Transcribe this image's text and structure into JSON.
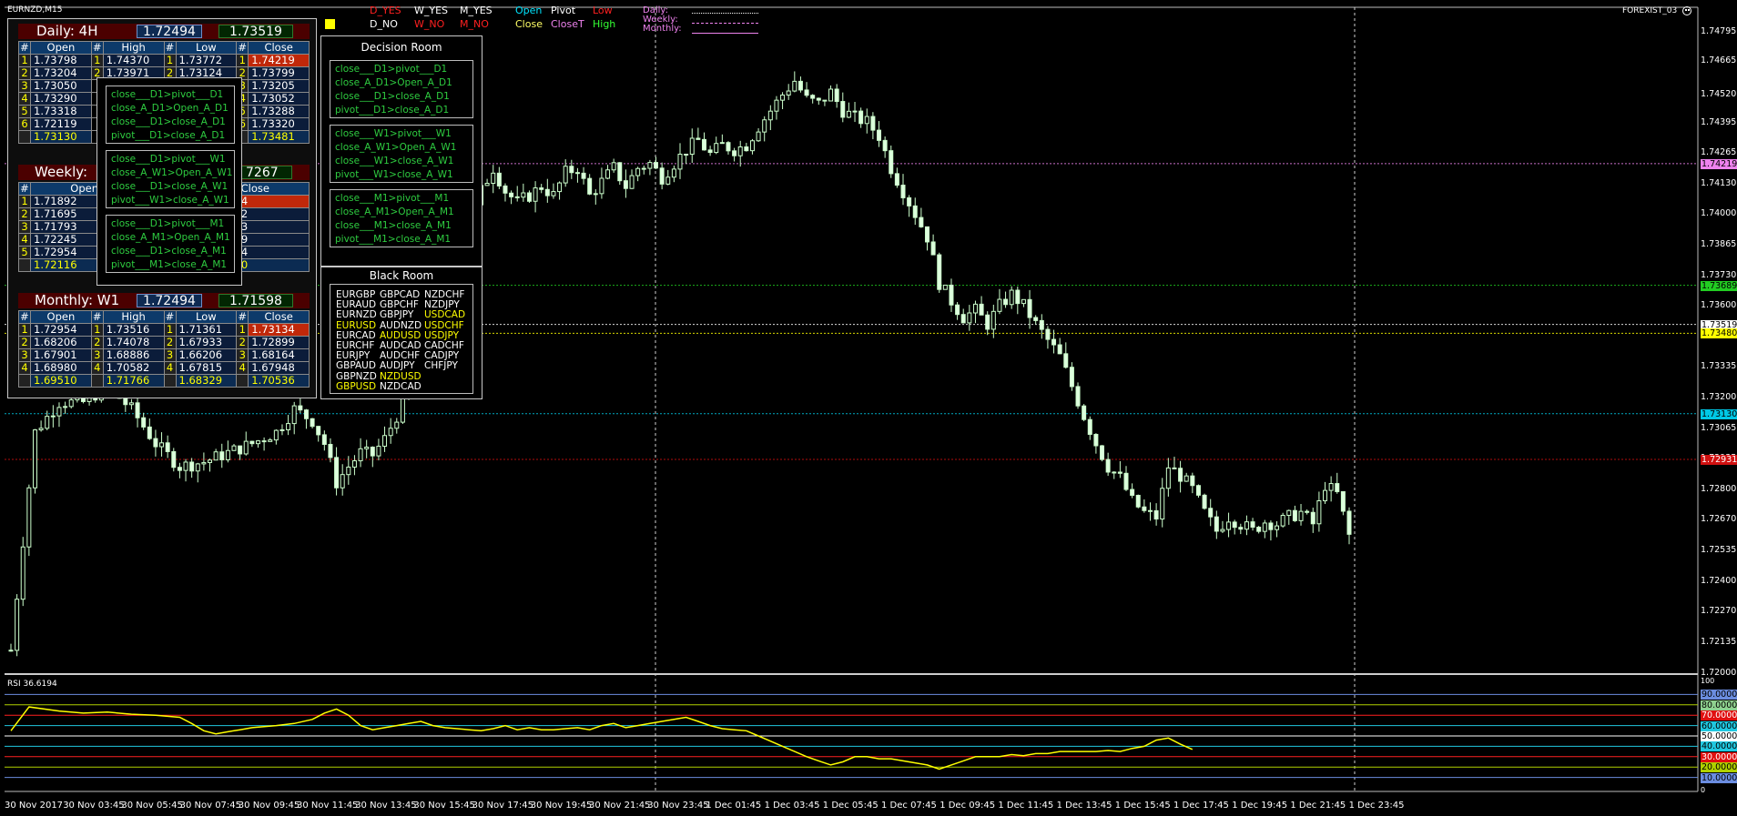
{
  "symbol": "EURNZD,M15",
  "broker": "FOREXIST_03",
  "smiley_icon": "smiley-icon",
  "legend": {
    "d_yes": "D_YES",
    "w_yes": "W_YES",
    "m_yes": "M_YES",
    "d_no": "D_NO",
    "w_no": "W_NO",
    "m_no": "M_NO",
    "open": "Open",
    "pivot": "Pivot",
    "low": "Low",
    "close": "Close",
    "closeT": "CloseT",
    "high": "High",
    "daily": "Daily:",
    "weekly": "Weekly:",
    "monthly": "Monthly:",
    "colors": {
      "red": "#ff2020",
      "white": "#ffffff",
      "cyan": "#00e5ff",
      "yellow": "#ffff66",
      "violet": "#ee82ee",
      "green": "#33ff33"
    }
  },
  "daily": {
    "title": "Daily:  4H",
    "val1": "1.72494",
    "val2": "1.73519",
    "headers": [
      "#",
      "Open",
      "#",
      "High",
      "#",
      "Low",
      "#",
      "Close"
    ],
    "rows": [
      [
        "1",
        "1.73798",
        "1",
        "1.74370",
        "1",
        "1.73772",
        "1",
        "1.74219"
      ],
      [
        "2",
        "1.73204",
        "2",
        "1.73971",
        "2",
        "1.73124",
        "2",
        "1.73799"
      ],
      [
        "3",
        "1.73050",
        "",
        "",
        "",
        "",
        "3",
        "1.73205"
      ],
      [
        "4",
        "1.73290",
        "",
        "",
        "",
        "",
        "4",
        "1.73052"
      ],
      [
        "5",
        "1.73318",
        "",
        "",
        "",
        "",
        "5",
        "1.73288"
      ],
      [
        "6",
        "1.72119",
        "",
        "",
        "",
        "",
        "6",
        "1.73320"
      ]
    ],
    "sums": [
      "1.73130",
      "1.73481"
    ]
  },
  "weekly": {
    "title": "Weekly:",
    "val2": "7267",
    "headers": [
      "#",
      "Open",
      "",
      "",
      "",
      "",
      "#",
      "Close"
    ],
    "rows": [
      [
        "1",
        "1.71892",
        "1",
        "1.73134"
      ],
      [
        "2",
        "1.71695",
        "2",
        "1.71872"
      ],
      [
        "3",
        "1.71793",
        "3",
        "1.71693"
      ],
      [
        "4",
        "1.72245",
        "4",
        "1.71759"
      ],
      [
        "5",
        "1.72954",
        "5",
        "1.72244"
      ]
    ],
    "sums": [
      "1.72116",
      "1.72140"
    ]
  },
  "monthly": {
    "title": "Monthly:   W1",
    "val1": "1.72494",
    "val2": "1.71598",
    "headers": [
      "#",
      "Open",
      "#",
      "High",
      "#",
      "Low",
      "#",
      "Close"
    ],
    "rows": [
      [
        "1",
        "1.72954",
        "1",
        "1.73516",
        "1",
        "1.71361",
        "1",
        "1.73134"
      ],
      [
        "2",
        "1.68206",
        "2",
        "1.74078",
        "2",
        "1.67933",
        "2",
        "1.72899"
      ],
      [
        "3",
        "1.67901",
        "3",
        "1.68886",
        "3",
        "1.66206",
        "3",
        "1.68164"
      ],
      [
        "4",
        "1.68980",
        "4",
        "1.70582",
        "4",
        "1.67815",
        "4",
        "1.67948"
      ]
    ],
    "sums": [
      "1.69510",
      "1.71766",
      "1.68329",
      "1.70536"
    ]
  },
  "overlay_conditions": [
    [
      "close___D1>pivot___D1",
      "close_A_D1>Open_A_D1",
      "close___D1>close_A_D1",
      "pivot___D1>close_A_D1"
    ],
    [
      "close___D1>pivot___W1",
      "close_A_W1>Open_A_W1",
      "close___D1>close_A_W1",
      "pivot___W1>close_A_W1"
    ],
    [
      "close___D1>pivot___M1",
      "close_A_M1>Open_A_M1",
      "close___D1>close_A_M1",
      "pivot___M1>close_A_M1"
    ]
  ],
  "decision_room": {
    "title": "Decision Room",
    "groups": [
      [
        "close___D1>pivot___D1",
        "close_A_D1>Open_A_D1",
        "close___D1>close_A_D1",
        "pivot___D1>close_A_D1"
      ],
      [
        "close___W1>pivot___W1",
        "close_A_W1>Open_A_W1",
        "close___W1>close_A_W1",
        "pivot___W1>close_A_W1"
      ],
      [
        "close___M1>pivot___M1",
        "close_A_M1>Open_A_M1",
        "close___M1>close_A_M1",
        "pivot___M1>close_A_M1"
      ]
    ]
  },
  "black_room": {
    "title": "Black Room",
    "col1": [
      "EURGBP",
      "EURAUD",
      "EURNZD",
      "EURUSD",
      "EURCAD",
      "EURCHF",
      "EURJPY",
      "GBPAUD",
      "GBPNZD",
      "GBPUSD"
    ],
    "col2": [
      "GBPCAD",
      "GBPCHF",
      "GBPJPY",
      "AUDNZD",
      "AUDUSD",
      "AUDCAD",
      "AUDCHF",
      "AUDJPY",
      "NZDUSD",
      "NZDCAD"
    ],
    "col3": [
      "NZDCHF",
      "NZDJPY",
      "USDCAD",
      "USDCHF",
      "USDJPY",
      "CADCHF",
      "CADJPY",
      "CHFJPY"
    ],
    "yellow": [
      "EURUSD",
      "GBPUSD",
      "AUDUSD",
      "NZDUSD",
      "USDCAD",
      "USDCHF",
      "USDJPY"
    ]
  },
  "price_axis": [
    "1.74795",
    "1.74665",
    "1.74520",
    "1.74395",
    "1.74265",
    "1.74130",
    "1.74000",
    "1.73865",
    "1.73730",
    "1.73600",
    "1.73465",
    "1.73335",
    "1.73200",
    "1.73065",
    "1.72935",
    "1.72800",
    "1.72670",
    "1.72535",
    "1.72400",
    "1.72270",
    "1.72135",
    "1.72000"
  ],
  "price_tags": [
    {
      "text": "1.74219",
      "bg": "#ee82ee"
    },
    {
      "text": "1.73689",
      "bg": "#22cc22"
    },
    {
      "text": "1.73519",
      "bg": "#ffffff"
    },
    {
      "text": "1.73480",
      "bg": "#ffff00"
    },
    {
      "text": "1.73130",
      "bg": "#00c8e6"
    },
    {
      "text": "1.72931",
      "bg": "#d01010"
    }
  ],
  "rsi": {
    "label": "RSI 36.6194",
    "axis": [
      "100",
      "0"
    ],
    "levels": [
      {
        "text": "90.0000",
        "bg": "#6b8de0",
        "line": "#6b8de0"
      },
      {
        "text": "80.0000",
        "bg": "#8fd18f",
        "line": "#b0d000"
      },
      {
        "text": "70.0000",
        "bg": "#e01010",
        "line": "#ff2020"
      },
      {
        "text": "60.0000",
        "bg": "#20c8e0",
        "line": "#20c8e0"
      },
      {
        "text": "50.0000",
        "bg": "#ffffff",
        "line": "#ffffff"
      },
      {
        "text": "40.0000",
        "bg": "#20c8e0",
        "line": "#20c8e0"
      },
      {
        "text": "30.0000",
        "bg": "#e01010",
        "line": "#ff2020"
      },
      {
        "text": "20.0000",
        "bg": "#b0d000",
        "line": "#b0d000"
      },
      {
        "text": "10.0000",
        "bg": "#6b8de0",
        "line": "#6b8de0"
      }
    ]
  },
  "time_axis": [
    "30 Nov 2017",
    "30 Nov 03:45",
    "30 Nov 05:45",
    "30 Nov 07:45",
    "30 Nov 09:45",
    "30 Nov 11:45",
    "30 Nov 13:45",
    "30 Nov 15:45",
    "30 Nov 17:45",
    "30 Nov 19:45",
    "30 Nov 21:45",
    "30 Nov 23:45",
    "1 Dec 01:45",
    "1 Dec 03:45",
    "1 Dec 05:45",
    "1 Dec 07:45",
    "1 Dec 09:45",
    "1 Dec 11:45",
    "1 Dec 13:45",
    "1 Dec 15:45",
    "1 Dec 17:45",
    "1 Dec 19:45",
    "1 Dec 21:45",
    "1 Dec 23:45"
  ],
  "chart_data": {
    "type": "candlestick",
    "symbol": "EURNZD",
    "timeframe": "M15",
    "ylim": [
      1.72,
      1.749
    ],
    "x_start": "30 Nov 2017 00:00",
    "hlines": [
      1.74219,
      1.73689,
      1.73519,
      1.7348,
      1.7313,
      1.72931
    ],
    "close_path": [
      [
        0,
        1.721
      ],
      [
        4,
        1.7305
      ],
      [
        8,
        1.7318
      ],
      [
        12,
        1.7318
      ],
      [
        16,
        1.7325
      ],
      [
        20,
        1.7315
      ],
      [
        24,
        1.73
      ],
      [
        28,
        1.729
      ],
      [
        32,
        1.7292
      ],
      [
        36,
        1.7296
      ],
      [
        40,
        1.73
      ],
      [
        44,
        1.7305
      ],
      [
        47,
        1.7315
      ],
      [
        50,
        1.731
      ],
      [
        52,
        1.73
      ],
      [
        54,
        1.7283
      ],
      [
        56,
        1.729
      ],
      [
        58,
        1.7296
      ],
      [
        60,
        1.7295
      ],
      [
        62,
        1.7302
      ],
      [
        64,
        1.7312
      ],
      [
        66,
        1.7322
      ],
      [
        68,
        1.734
      ],
      [
        70,
        1.736
      ],
      [
        72,
        1.7372
      ],
      [
        74,
        1.7385
      ],
      [
        76,
        1.7395
      ],
      [
        78,
        1.741
      ],
      [
        80,
        1.742
      ],
      [
        82,
        1.741
      ],
      [
        84,
        1.7405
      ],
      [
        86,
        1.7408
      ],
      [
        88,
        1.7412
      ],
      [
        90,
        1.7408
      ],
      [
        92,
        1.7418
      ],
      [
        94,
        1.742
      ],
      [
        96,
        1.7408
      ],
      [
        98,
        1.7414
      ],
      [
        100,
        1.742
      ],
      [
        102,
        1.7412
      ],
      [
        104,
        1.742
      ],
      [
        106,
        1.7422
      ],
      [
        108,
        1.7416
      ],
      [
        110,
        1.7422
      ],
      [
        112,
        1.7428
      ],
      [
        114,
        1.7432
      ],
      [
        116,
        1.7426
      ],
      [
        118,
        1.743
      ],
      [
        120,
        1.7428
      ],
      [
        122,
        1.743
      ],
      [
        124,
        1.7438
      ],
      [
        126,
        1.7445
      ],
      [
        128,
        1.7452
      ],
      [
        130,
        1.7458
      ],
      [
        132,
        1.745
      ],
      [
        134,
        1.7448
      ],
      [
        136,
        1.7453
      ],
      [
        138,
        1.7445
      ],
      [
        140,
        1.7442
      ],
      [
        142,
        1.744
      ],
      [
        144,
        1.7434
      ],
      [
        146,
        1.742
      ],
      [
        148,
        1.741
      ],
      [
        150,
        1.74
      ],
      [
        152,
        1.739
      ],
      [
        154,
        1.737
      ],
      [
        156,
        1.7362
      ],
      [
        158,
        1.7355
      ],
      [
        160,
        1.7358
      ],
      [
        162,
        1.7352
      ],
      [
        164,
        1.736
      ],
      [
        166,
        1.7365
      ],
      [
        168,
        1.736
      ],
      [
        170,
        1.7352
      ],
      [
        172,
        1.7345
      ],
      [
        174,
        1.7338
      ],
      [
        176,
        1.7325
      ],
      [
        178,
        1.7312
      ],
      [
        180,
        1.73
      ],
      [
        182,
        1.729
      ],
      [
        184,
        1.7285
      ],
      [
        186,
        1.7275
      ],
      [
        188,
        1.727
      ],
      [
        190,
        1.7268
      ],
      [
        192,
        1.729
      ],
      [
        194,
        1.7286
      ],
      [
        196,
        1.728
      ],
      [
        198,
        1.727
      ],
      [
        200,
        1.7262
      ],
      [
        202,
        1.7268
      ],
      [
        204,
        1.7265
      ],
      [
        206,
        1.7262
      ],
      [
        208,
        1.7266
      ],
      [
        210,
        1.7265
      ],
      [
        212,
        1.7268
      ],
      [
        214,
        1.727
      ],
      [
        216,
        1.7265
      ],
      [
        218,
        1.7282
      ],
      [
        220,
        1.7278
      ],
      [
        222,
        1.726
      ]
    ],
    "rsi_ylim": [
      0,
      100
    ],
    "rsi_path": [
      [
        0,
        55
      ],
      [
        3,
        78
      ],
      [
        8,
        74
      ],
      [
        12,
        72
      ],
      [
        16,
        73
      ],
      [
        20,
        71
      ],
      [
        24,
        70
      ],
      [
        28,
        68
      ],
      [
        30,
        62
      ],
      [
        32,
        55
      ],
      [
        34,
        52
      ],
      [
        36,
        54
      ],
      [
        38,
        56
      ],
      [
        40,
        58
      ],
      [
        44,
        60
      ],
      [
        47,
        62
      ],
      [
        50,
        66
      ],
      [
        52,
        72
      ],
      [
        54,
        76
      ],
      [
        56,
        70
      ],
      [
        58,
        60
      ],
      [
        60,
        56
      ],
      [
        62,
        58
      ],
      [
        64,
        60
      ],
      [
        66,
        62
      ],
      [
        68,
        64
      ],
      [
        70,
        60
      ],
      [
        72,
        58
      ],
      [
        74,
        57
      ],
      [
        76,
        56
      ],
      [
        78,
        55
      ],
      [
        80,
        57
      ],
      [
        82,
        60
      ],
      [
        84,
        56
      ],
      [
        86,
        58
      ],
      [
        88,
        56
      ],
      [
        90,
        56
      ],
      [
        92,
        57
      ],
      [
        94,
        58
      ],
      [
        96,
        56
      ],
      [
        98,
        60
      ],
      [
        100,
        62
      ],
      [
        102,
        58
      ],
      [
        104,
        60
      ],
      [
        106,
        62
      ],
      [
        108,
        64
      ],
      [
        110,
        66
      ],
      [
        112,
        68
      ],
      [
        114,
        64
      ],
      [
        116,
        60
      ],
      [
        118,
        57
      ],
      [
        120,
        56
      ],
      [
        122,
        55
      ],
      [
        124,
        50
      ],
      [
        126,
        45
      ],
      [
        128,
        40
      ],
      [
        130,
        35
      ],
      [
        132,
        30
      ],
      [
        134,
        26
      ],
      [
        136,
        22
      ],
      [
        138,
        25
      ],
      [
        140,
        30
      ],
      [
        142,
        30
      ],
      [
        144,
        28
      ],
      [
        146,
        28
      ],
      [
        148,
        26
      ],
      [
        150,
        24
      ],
      [
        152,
        22
      ],
      [
        154,
        18
      ],
      [
        156,
        22
      ],
      [
        158,
        26
      ],
      [
        160,
        30
      ],
      [
        162,
        30
      ],
      [
        164,
        30
      ],
      [
        166,
        32
      ],
      [
        168,
        31
      ],
      [
        170,
        33
      ],
      [
        172,
        33
      ],
      [
        174,
        35
      ],
      [
        176,
        35
      ],
      [
        178,
        35
      ],
      [
        180,
        35
      ],
      [
        182,
        36
      ],
      [
        184,
        35
      ],
      [
        186,
        38
      ],
      [
        188,
        40
      ],
      [
        190,
        46
      ],
      [
        192,
        48
      ],
      [
        194,
        42
      ],
      [
        196,
        37
      ]
    ]
  }
}
